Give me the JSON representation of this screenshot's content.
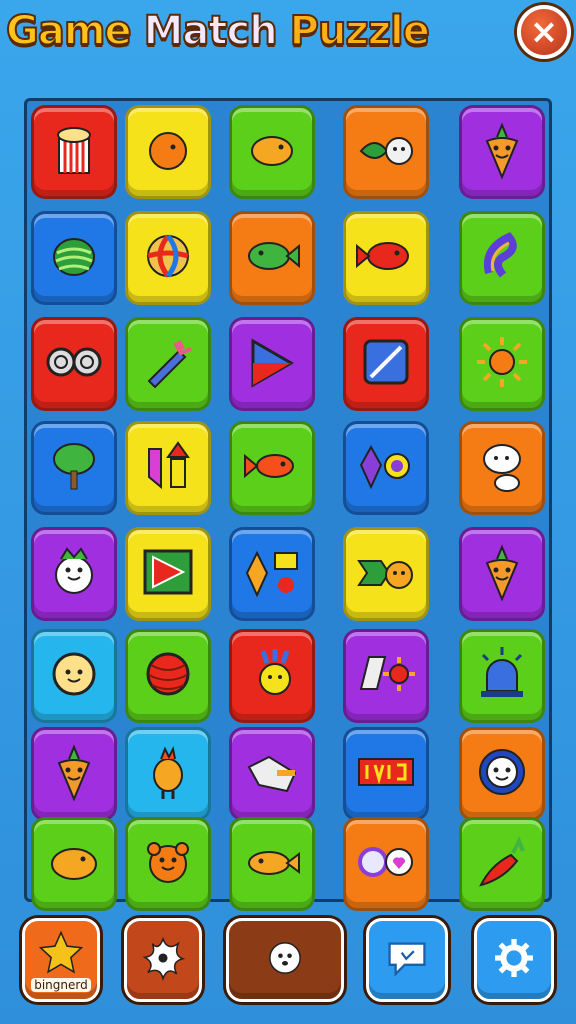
{
  "title": {
    "word1": "Game",
    "word2": "Match",
    "word3": "Puzzle"
  },
  "close_symbol": "×",
  "colors": {
    "red": "#e8281c",
    "orange": "#f57c14",
    "yellow": "#f5e21a",
    "green": "#5ccf1a",
    "blue": "#1f78e6",
    "purple": "#a02fe0",
    "cyan": "#25b6ee",
    "pink": "#d93fd2"
  },
  "tiles": [
    [
      "red:popcorn-icon",
      "yellow:orange-fish-icon",
      "green:chick-icon",
      "orange:leaf-face-icon",
      "purple:carrot-face-icon"
    ],
    [
      "blue:seashell-icon",
      "yellow:beach-ball-icon",
      "orange:green-fish-icon",
      "yellow:red-fish-icon",
      "green:swirl-icon"
    ],
    [
      "red:binoculars-icon",
      "green:rocket-fish-icon",
      "purple:play-arrow-icon",
      "red:crystal-card-icon",
      "green:sun-icon"
    ],
    [
      "blue:tree-icon",
      "yellow:arrows-icon",
      "green:goldfish-icon",
      "blue:gems-icon",
      "orange:ghost-face-icon"
    ],
    [
      "purple:radish-face-icon",
      "yellow:play-card-icon",
      "blue:diamond-set-icon",
      "yellow:arrow-face-icon",
      "purple:carrot-face-icon"
    ],
    [
      "cyan:smiley-face-icon",
      "green:striped-ball-icon",
      "red:feather-face-icon",
      "purple:book-flower-icon",
      "green:siren-icon"
    ],
    [
      "purple:carrot-face-icon",
      "cyan:rooster-icon",
      "purple:crystal-icon",
      "blue:dvd-sign-icon",
      "orange:flower-face-icon"
    ],
    [
      "green:yellow-bird-icon",
      "green:bear-face-icon",
      "green:yellow-fish-icon",
      "orange:swirl-heart-icon",
      "green:chili-icon"
    ]
  ],
  "bottom_buttons": [
    {
      "name": "star-button",
      "icon": "star-icon",
      "label": "bingnerd",
      "color": "#f06a1c"
    },
    {
      "name": "burst-button",
      "icon": "burst-icon",
      "label": "",
      "color": "#c2471b"
    },
    {
      "name": "pet-button",
      "icon": "pet-face-icon",
      "label": "",
      "color": "#8b3c16"
    },
    {
      "name": "chat-button",
      "icon": "speech-bubble-icon",
      "label": "",
      "color": "#2d9bf0"
    },
    {
      "name": "settings-button",
      "icon": "gear-icon",
      "label": "",
      "color": "#2d9bf0"
    }
  ]
}
